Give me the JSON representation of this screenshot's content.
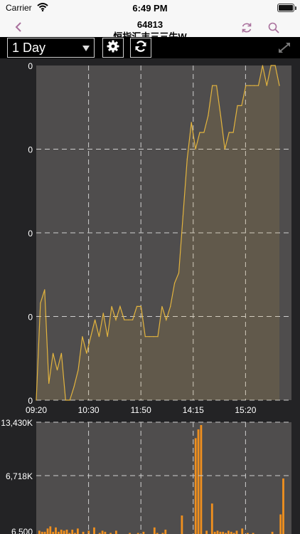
{
  "status": {
    "carrier": "Carrier",
    "time": "6:49 PM"
  },
  "nav": {
    "title_line1": "64813",
    "title_line2": "恒指汇丰三三牛W"
  },
  "toolbar": {
    "period": "1 Day"
  },
  "icons": {
    "back": "chevron-left-icon",
    "refresh": "refresh-icon",
    "search": "search-icon",
    "settings": "gear-icon",
    "reload": "reload-icon",
    "expand": "expand-icon",
    "wifi": "wifi-icon",
    "battery": "battery-icon"
  },
  "colors": {
    "accent": "#a9709c",
    "price_line": "#e3b43e",
    "volume_bar": "#f0901e",
    "plot_bg": "#4f4d4d",
    "background": "#232325"
  },
  "chart_data": [
    {
      "type": "line",
      "x_ticks": [
        "09:20",
        "10:30",
        "11:50",
        "14:15",
        "15:20"
      ],
      "y_ticks": [
        "0",
        "0",
        "0",
        "0",
        "0"
      ],
      "x": [
        0,
        1,
        2,
        3,
        4,
        5,
        6,
        7,
        8,
        9,
        10,
        11,
        12,
        13,
        14,
        15,
        16,
        17,
        18,
        19,
        20,
        21,
        22,
        23,
        24,
        25,
        26,
        27,
        28,
        29,
        30,
        31,
        32,
        33,
        34,
        35,
        36,
        37,
        38,
        39,
        40,
        41,
        42,
        43,
        44,
        45,
        46,
        47,
        48,
        49,
        50,
        51,
        52,
        53,
        54,
        55,
        56,
        57,
        58,
        59,
        60,
        61,
        62,
        63
      ],
      "values": [
        0.0,
        0.29,
        0.33,
        0.05,
        0.14,
        0.09,
        0.14,
        0.0,
        0.0,
        0.04,
        0.09,
        0.19,
        0.14,
        0.19,
        0.24,
        0.19,
        0.26,
        0.19,
        0.28,
        0.24,
        0.28,
        0.24,
        0.24,
        0.24,
        0.28,
        0.28,
        0.19,
        0.19,
        0.19,
        0.19,
        0.28,
        0.24,
        0.28,
        0.35,
        0.38,
        0.55,
        0.72,
        0.83,
        0.75,
        0.8,
        0.8,
        0.85,
        0.94,
        0.94,
        0.85,
        0.75,
        0.8,
        0.8,
        0.88,
        0.88,
        0.94,
        0.94,
        0.94,
        0.94,
        1.0,
        0.94,
        1.0,
        1.0,
        0.94
      ],
      "ylim": [
        0,
        1
      ],
      "grid": true
    },
    {
      "type": "bar",
      "y_ticks": [
        "13,430K",
        "6,718K",
        "6,500"
      ],
      "values": [
        0.03,
        0.02,
        0.02,
        0.05,
        0.07,
        0.02,
        0.06,
        0.02,
        0.04,
        0.03,
        0.04,
        0.01,
        0.04,
        0.01,
        0.05,
        0.0,
        0.02,
        0.0,
        0.03,
        0.0,
        0.06,
        0.0,
        0.01,
        0.03,
        0.02,
        0.0,
        0.01,
        0.0,
        0.03,
        0.0,
        0.0,
        0.0,
        0.0,
        0.01,
        0.0,
        0.0,
        0.01,
        0.0,
        0.02,
        0.0,
        0.0,
        0.0,
        0.06,
        0.01,
        0.0,
        0.01,
        0.04,
        0.0,
        0.0,
        0.0,
        0.0,
        0.0,
        0.17,
        0.0,
        0.0,
        0.0,
        0.0,
        0.88,
        0.96,
        1.0,
        0.0,
        0.03,
        0.0,
        0.28,
        0.02,
        0.03,
        0.02,
        0.02,
        0.01,
        0.03,
        0.02,
        0.01,
        0.03,
        0.0,
        0.05,
        0.0,
        0.01,
        0.0,
        0.01,
        0.0,
        0.0,
        0.0,
        0.0,
        0.0,
        0.0,
        0.02,
        0.0,
        0.0,
        0.18,
        0.51
      ],
      "ylim": [
        0,
        1
      ],
      "grid": true
    }
  ]
}
